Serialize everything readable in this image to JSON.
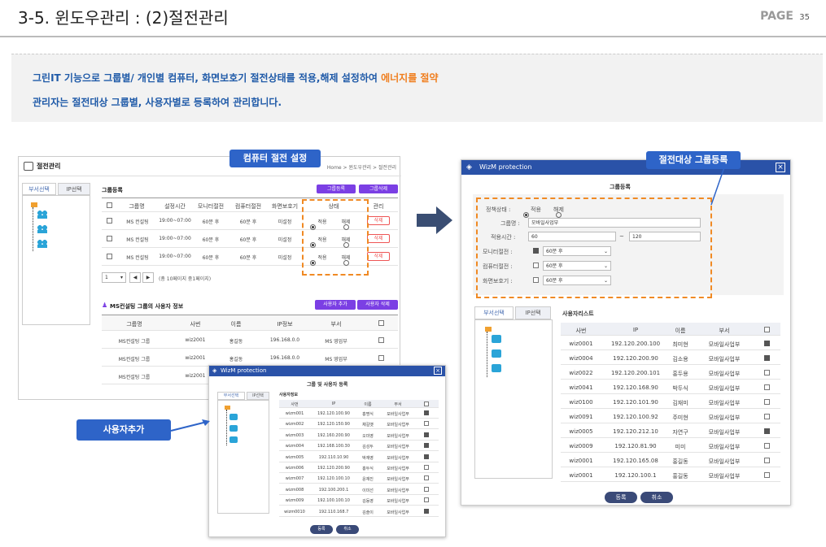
{
  "page": {
    "title": "3-5. 윈도우관리 : (2)절전관리",
    "page_label": "PAGE",
    "page_num": "35"
  },
  "banner": {
    "line1_a": "그린IT 기능으로 그룹별/ 개인별 컴퓨터, 화면보호기 절전상태를 적용,해제 설정하여 ",
    "line1_hl": "에너지를 절약",
    "line2": "관리자는 절전대상 그룹별, 사용자별로 등록하여 관리합니다."
  },
  "callouts": {
    "computer": "컴퓨터 절전 설정",
    "group": "절전대상 그룹등록",
    "user": "사용자추가"
  },
  "left": {
    "title": "절전관리",
    "breadcrumb": "Home > 윈도우관리 > 절전관리",
    "tabs": [
      "부서선택",
      "IP선택"
    ],
    "group_label": "그룹등록",
    "btn_reg": "그룹등록",
    "btn_del": "그룹삭제",
    "cols": [
      "그룹명",
      "설정시간",
      "모니터절전",
      "컴퓨터절전",
      "화면보호기",
      "상태",
      "관리"
    ],
    "rows": [
      {
        "name": "MS 컨설팅",
        "time": "19:00~07:00",
        "mon": "60분 후",
        "com": "60분 후",
        "scr": "미설정",
        "apply": "적용",
        "release": "해제",
        "del": "삭제"
      },
      {
        "name": "MS 컨설팅",
        "time": "19:00~07:00",
        "mon": "60분 후",
        "com": "60분 후",
        "scr": "미설정",
        "apply": "적용",
        "release": "해제",
        "del": "삭제"
      },
      {
        "name": "MS 컨설팅",
        "time": "19:00~07:00",
        "mon": "60분 후",
        "com": "60분 후",
        "scr": "미설정",
        "apply": "적용",
        "release": "해제",
        "del": "삭제"
      }
    ],
    "pager_val": "1",
    "pager_text": "(총 10페이지 중1페이지)",
    "user_title": "MS컨설팅 그룹의 사용자 정보",
    "btn_user_add": "사용자 추가",
    "btn_user_del": "사용자 삭제",
    "user_cols": [
      "그룹명",
      "사번",
      "이름",
      "IP정보",
      "부서"
    ],
    "user_rows": [
      [
        "MS컨설팅 그룹",
        "wiz2001",
        "홍길동",
        "196.168.0.0",
        "MS 영업부"
      ],
      [
        "MS컨설팅 그룹",
        "wiz2001",
        "홍길동",
        "196.168.0.0",
        "MS 영업부"
      ],
      [
        "MS컨설팅 그룹",
        "wiz2001",
        "",
        "",
        ""
      ]
    ]
  },
  "popup_small": {
    "header": "WizM protection",
    "title": "그룹 및 사용자 등록",
    "tabs": [
      "부서선택",
      "IP선택"
    ],
    "section": "사용자정보",
    "cols": [
      "사번",
      "IP",
      "이름",
      "부서"
    ],
    "rows": [
      [
        "wizm001",
        "192.120.100.90",
        "홍명식",
        "모바일사업부",
        true
      ],
      [
        "wizm002",
        "192.120.150.90",
        "채길뱃",
        "모바일사업부",
        false
      ],
      [
        "wizm003",
        "192.160.200.90",
        "오미영",
        "모바일사업부",
        true
      ],
      [
        "wizm004",
        "192.168.100.30",
        "김성두",
        "모바일사업부",
        true
      ],
      [
        "wizm005",
        "192.110.10.90",
        "박재영",
        "모바일사업부",
        true
      ],
      [
        "wizm006",
        "192.120.200.90",
        "홍두식",
        "모바일사업부",
        false
      ],
      [
        "wizm007",
        "192.120.100.10",
        "윤재진",
        "모바일사업부",
        false
      ],
      [
        "wizm008",
        "192.100.200.1",
        "이미선",
        "모바일사업부",
        false
      ],
      [
        "wizm009",
        "192.100.100.10",
        "김동영",
        "모바일사업부",
        false
      ],
      [
        "wizm0010",
        "192.110.168.7",
        "김솔이",
        "모바일사업부",
        true
      ]
    ],
    "btn_ok": "등록",
    "btn_cancel": "취소"
  },
  "popup_right": {
    "header": "WizM protection",
    "title": "그룹등록",
    "policy_label": "정책상태 :",
    "policy_apply": "적용",
    "policy_release": "해제",
    "group_label": "그룹명 :",
    "group_val": "모바일사업부",
    "time_label": "적용시간 :",
    "time_from": "60",
    "time_sep": "~",
    "time_to": "120",
    "mon_label": "모니터절전 :",
    "mon_val": "60분 후",
    "com_label": "컴퓨터절전 :",
    "com_val": "60분 후",
    "scr_label": "화면보호기 :",
    "scr_val": "60분 후",
    "tabs": [
      "부서선택",
      "IP선택"
    ],
    "list_title": "사용자리스트",
    "cols": [
      "사번",
      "IP",
      "이름",
      "부서"
    ],
    "rows": [
      [
        "wiz0001",
        "192.120.200.100",
        "최미현",
        "모바일사업부",
        true
      ],
      [
        "wiz0004",
        "192.120.200.90",
        "김소용",
        "모바일사업부",
        true
      ],
      [
        "wiz0022",
        "192.120.200.101",
        "홍두용",
        "모바일사업부",
        false
      ],
      [
        "wiz0041",
        "192.120.168.90",
        "박두식",
        "모바일사업부",
        false
      ],
      [
        "wiz0100",
        "192.120.101.90",
        "김재미",
        "모바일사업부",
        false
      ],
      [
        "wiz0091",
        "192.120.100.92",
        "주미현",
        "모바일사업부",
        false
      ],
      [
        "wiz0005",
        "192.120.212.10",
        "자연구",
        "모바일사업부",
        true
      ],
      [
        "wiz0009",
        "192.120.81.90",
        "미미",
        "모바일사업부",
        false
      ],
      [
        "wiz0001",
        "192.120.165.08",
        "홍길동",
        "모바일사업부",
        false
      ],
      [
        "wiz0001",
        "192.120.100.1",
        "홍길동",
        "모바일사업부",
        false
      ]
    ],
    "btn_ok": "등록",
    "btn_cancel": "취소"
  },
  "colors": {
    "accent": "#2e64c8",
    "highlight": "#f07e1e",
    "purple": "#7b3fe4"
  }
}
